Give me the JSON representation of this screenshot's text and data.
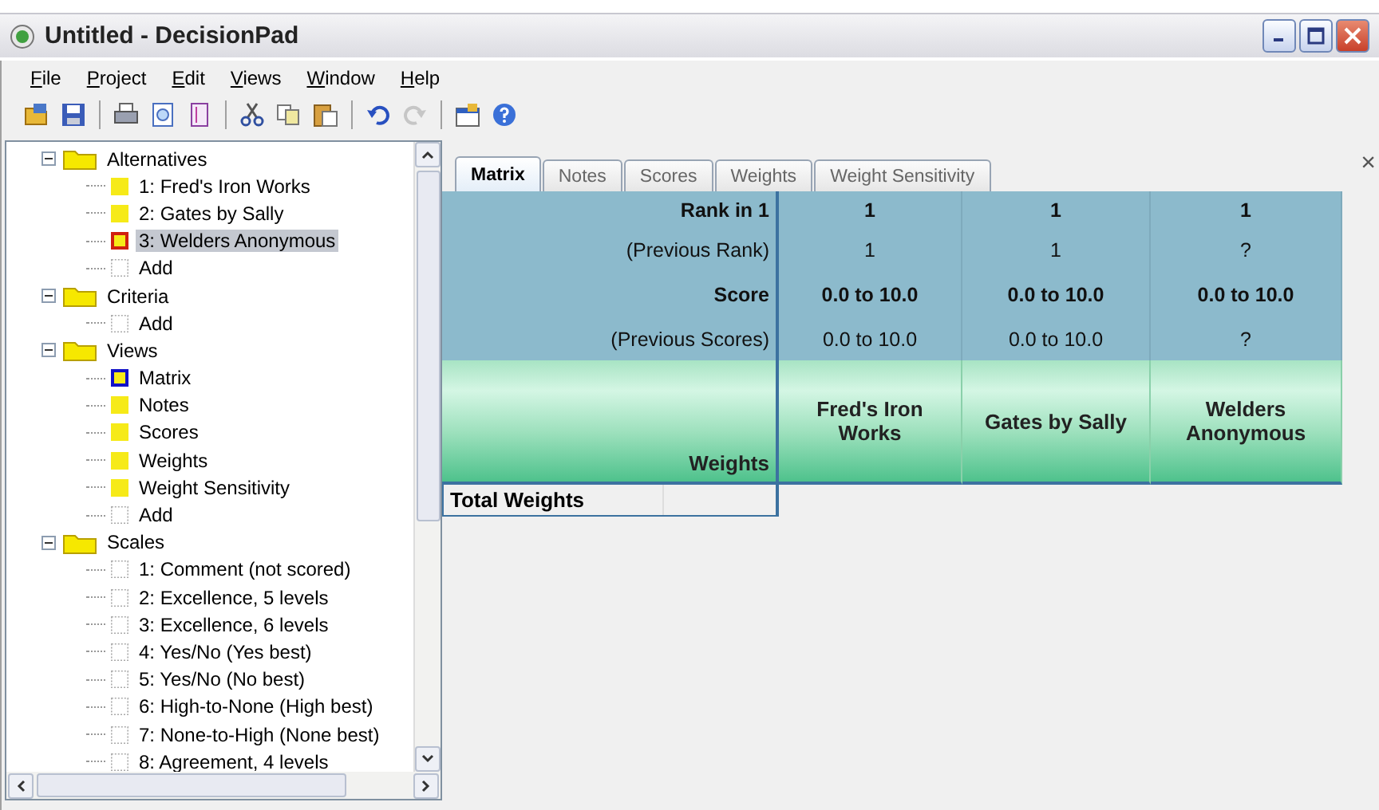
{
  "window": {
    "title": "Untitled - DecisionPad"
  },
  "menu": [
    {
      "label": "File"
    },
    {
      "label": "Project"
    },
    {
      "label": "Edit"
    },
    {
      "label": "Views"
    },
    {
      "label": "Window"
    },
    {
      "label": "Help"
    }
  ],
  "toolbar": [
    [
      {
        "kind": "open",
        "disabled": false
      },
      {
        "kind": "save",
        "disabled": false
      }
    ],
    [
      {
        "kind": "print",
        "disabled": false
      },
      {
        "kind": "preview",
        "disabled": false
      },
      {
        "kind": "page",
        "disabled": false
      }
    ],
    [
      {
        "kind": "cut",
        "disabled": false
      },
      {
        "kind": "copy",
        "disabled": false
      },
      {
        "kind": "paste",
        "disabled": false
      }
    ],
    [
      {
        "kind": "undo",
        "disabled": false
      },
      {
        "kind": "redo",
        "disabled": true
      }
    ],
    [
      {
        "kind": "properties",
        "disabled": false
      },
      {
        "kind": "help",
        "disabled": false
      }
    ]
  ],
  "tree": [
    {
      "label": "Alternatives",
      "kind": "folder",
      "expanded": true,
      "selected": false,
      "children": [
        {
          "label": "1: Fred's Iron Works",
          "kind": "item",
          "selected": false
        },
        {
          "label": "2: Gates by Sally",
          "kind": "item",
          "selected": false
        },
        {
          "label": "3: Welders Anonymous",
          "kind": "marked",
          "selected": true
        },
        {
          "label": "Add",
          "kind": "add",
          "selected": false
        }
      ]
    },
    {
      "label": "Criteria",
      "kind": "folder",
      "expanded": true,
      "selected": false,
      "children": [
        {
          "label": "Add",
          "kind": "add",
          "selected": false
        }
      ]
    },
    {
      "label": "Views",
      "kind": "folder",
      "expanded": true,
      "selected": false,
      "children": [
        {
          "label": "Matrix",
          "kind": "current",
          "selected": false
        },
        {
          "label": "Notes",
          "kind": "item",
          "selected": false
        },
        {
          "label": "Scores",
          "kind": "item",
          "selected": false
        },
        {
          "label": "Weights",
          "kind": "item",
          "selected": false
        },
        {
          "label": "Weight Sensitivity",
          "kind": "item",
          "selected": false
        },
        {
          "label": "Add",
          "kind": "add",
          "selected": false
        }
      ]
    },
    {
      "label": "Scales",
      "kind": "folder",
      "expanded": true,
      "selected": false,
      "children": [
        {
          "label": "1: Comment (not scored)",
          "kind": "add",
          "selected": false
        },
        {
          "label": "2: Excellence, 5 levels",
          "kind": "add",
          "selected": false
        },
        {
          "label": "3: Excellence, 6 levels",
          "kind": "add",
          "selected": false
        },
        {
          "label": "4: Yes/No (Yes best)",
          "kind": "add",
          "selected": false
        },
        {
          "label": "5: Yes/No (No best)",
          "kind": "add",
          "selected": false
        },
        {
          "label": "6: High-to-None (High best)",
          "kind": "add",
          "selected": false
        },
        {
          "label": "7: None-to-High (None best)",
          "kind": "add",
          "selected": false
        },
        {
          "label": "8: Agreement, 4 levels",
          "kind": "add",
          "selected": false
        }
      ]
    }
  ],
  "tabs": [
    {
      "label": "Matrix",
      "selected": true
    },
    {
      "label": "Notes",
      "selected": false
    },
    {
      "label": "Scores",
      "selected": false
    },
    {
      "label": "Weights",
      "selected": false
    },
    {
      "label": "Weight Sensitivity",
      "selected": false
    }
  ],
  "close_label": "×",
  "matrix": {
    "rows": [
      {
        "label": "Rank in 1",
        "kind": "main",
        "values": [
          "1",
          "1",
          "1"
        ]
      },
      {
        "label": "(Previous Rank)",
        "kind": "previous",
        "values": [
          "1",
          "1",
          "?"
        ]
      },
      {
        "label": "Score",
        "kind": "main",
        "values": [
          "0.0 to 10.0",
          "0.0 to 10.0",
          "0.0 to 10.0"
        ]
      },
      {
        "label": "(Previous Scores)",
        "kind": "previous",
        "values": [
          "0.0 to 10.0",
          "0.0 to 10.0",
          "?"
        ]
      }
    ],
    "weights_label": "Weights",
    "alternatives": [
      "Fred's Iron Works",
      "Gates by Sally",
      "Welders Anonymous"
    ],
    "total_label": "Total Weights"
  }
}
